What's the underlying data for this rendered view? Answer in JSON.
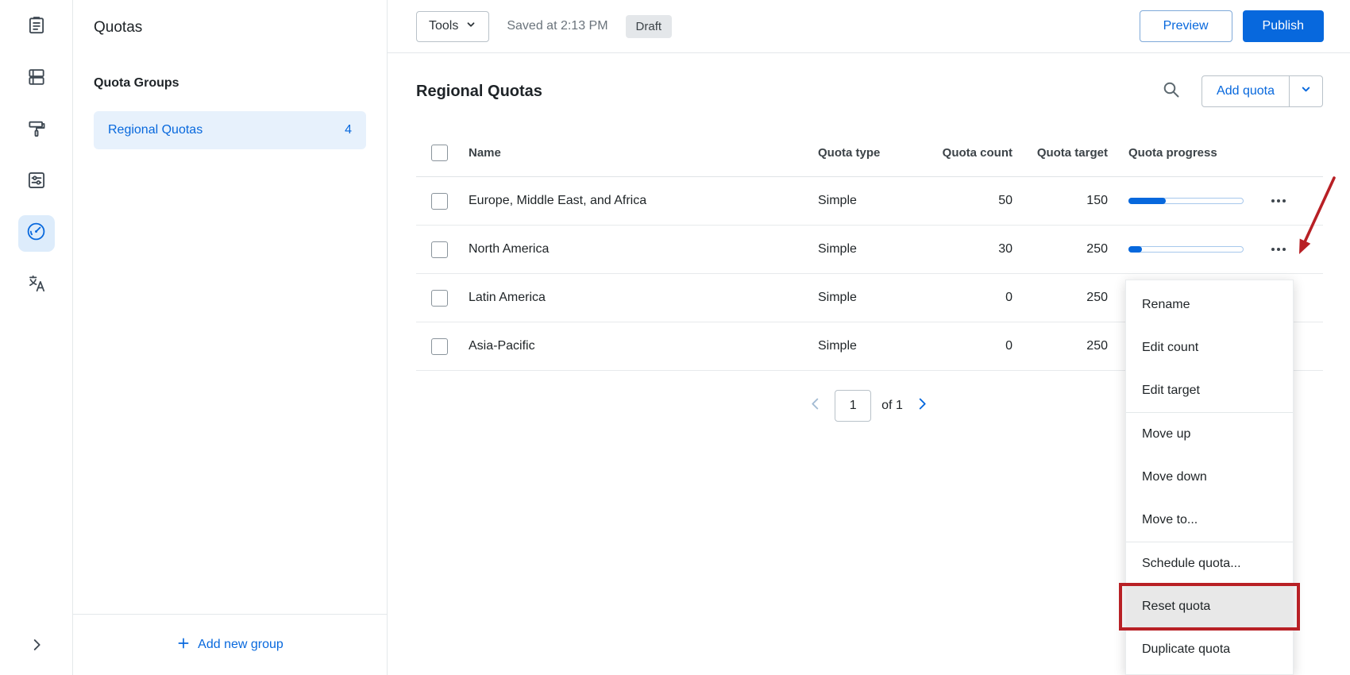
{
  "colors": {
    "accent": "#0768dd",
    "annotation_red": "#b82025",
    "selected_bg": "#e7f1fc"
  },
  "rail": {
    "items": [
      "survey-builder",
      "blocks",
      "look-and-feel",
      "survey-options",
      "quotas",
      "translations"
    ],
    "selected": "quotas"
  },
  "panel": {
    "title": "Quotas",
    "groups_heading": "Quota Groups",
    "group": {
      "label": "Regional Quotas",
      "count": "4"
    },
    "add_group_label": "Add new group"
  },
  "topbar": {
    "tools_label": "Tools",
    "saved_text": "Saved at 2:13 PM",
    "draft_label": "Draft",
    "preview_label": "Preview",
    "publish_label": "Publish"
  },
  "section": {
    "title": "Regional Quotas",
    "add_quota_label": "Add quota"
  },
  "table": {
    "headers": [
      "Name",
      "Quota type",
      "Quota count",
      "Quota target",
      "Quota progress"
    ],
    "rows": [
      {
        "name": "Europe, Middle East, and Africa",
        "type": "Simple",
        "count": "50",
        "target": "150",
        "progress_pct": 33
      },
      {
        "name": "North America",
        "type": "Simple",
        "count": "30",
        "target": "250",
        "progress_pct": 12
      },
      {
        "name": "Latin America",
        "type": "Simple",
        "count": "0",
        "target": "250",
        "progress_pct": 0
      },
      {
        "name": "Asia-Pacific",
        "type": "Simple",
        "count": "0",
        "target": "250",
        "progress_pct": 0
      }
    ]
  },
  "pagination": {
    "current_page": "1",
    "of_label": "of 1"
  },
  "context_menu": {
    "items": [
      "Rename",
      "Edit count",
      "Edit target",
      "Move up",
      "Move down",
      "Move to...",
      "Schedule quota...",
      "Reset quota",
      "Duplicate quota"
    ],
    "highlighted_item": "Reset quota"
  }
}
